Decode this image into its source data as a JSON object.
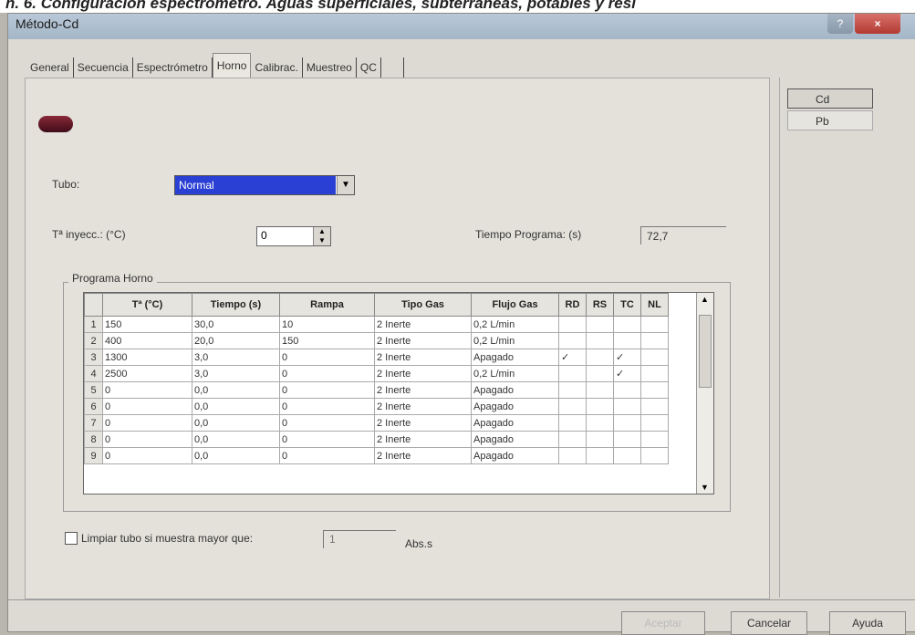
{
  "caption": "n. 6. Configuración espectrómetro. Aguas superficiales, subterráneas, potables y resi",
  "window": {
    "title": "Método-Cd",
    "help_label": "?",
    "close_label": "×"
  },
  "tabs": [
    "General",
    "Secuencia",
    "Espectrómetro",
    "Horno",
    "Calibrac.",
    "Muestreo",
    "QC"
  ],
  "active_tab": "Horno",
  "elements": [
    "Cd",
    "Pb"
  ],
  "form": {
    "tubo_label": "Tubo:",
    "tubo_value": "Normal",
    "tiny_label": "Tª inyecc.: (°C)",
    "tiny_value": "0",
    "tiempo_label": "Tiempo Programa: (s)",
    "tiempo_value": "72,7"
  },
  "program": {
    "group_label": "Programa Horno",
    "headers": [
      "Tª (°C)",
      "Tiempo (s)",
      "Rampa",
      "Tipo Gas",
      "Flujo Gas",
      "RD",
      "RS",
      "TC",
      "NL"
    ],
    "rows": [
      {
        "n": "1",
        "t": "150",
        "time": "30,0",
        "rampa": "10",
        "gas": "2 Inerte",
        "flujo": "0,2 L/min",
        "rd": "",
        "rs": "",
        "tc": "",
        "nl": ""
      },
      {
        "n": "2",
        "t": "400",
        "time": "20,0",
        "rampa": "150",
        "gas": "2 Inerte",
        "flujo": "0,2 L/min",
        "rd": "",
        "rs": "",
        "tc": "",
        "nl": ""
      },
      {
        "n": "3",
        "t": "1300",
        "time": "3,0",
        "rampa": "0",
        "gas": "2 Inerte",
        "flujo": "Apagado",
        "rd": "✓",
        "rs": "",
        "tc": "✓",
        "nl": ""
      },
      {
        "n": "4",
        "t": "2500",
        "time": "3,0",
        "rampa": "0",
        "gas": "2 Inerte",
        "flujo": "0,2 L/min",
        "rd": "",
        "rs": "",
        "tc": "✓",
        "nl": ""
      },
      {
        "n": "5",
        "t": "0",
        "time": "0,0",
        "rampa": "0",
        "gas": "2 Inerte",
        "flujo": "Apagado",
        "rd": "",
        "rs": "",
        "tc": "",
        "nl": ""
      },
      {
        "n": "6",
        "t": "0",
        "time": "0,0",
        "rampa": "0",
        "gas": "2 Inerte",
        "flujo": "Apagado",
        "rd": "",
        "rs": "",
        "tc": "",
        "nl": ""
      },
      {
        "n": "7",
        "t": "0",
        "time": "0,0",
        "rampa": "0",
        "gas": "2 Inerte",
        "flujo": "Apagado",
        "rd": "",
        "rs": "",
        "tc": "",
        "nl": ""
      },
      {
        "n": "8",
        "t": "0",
        "time": "0,0",
        "rampa": "0",
        "gas": "2 Inerte",
        "flujo": "Apagado",
        "rd": "",
        "rs": "",
        "tc": "",
        "nl": ""
      },
      {
        "n": "9",
        "t": "0",
        "time": "0,0",
        "rampa": "0",
        "gas": "2 Inerte",
        "flujo": "Apagado",
        "rd": "",
        "rs": "",
        "tc": "",
        "nl": ""
      }
    ]
  },
  "clean": {
    "label": "Limpiar tubo si muestra mayor que:",
    "value": "1",
    "unit": "Abs.s"
  },
  "buttons": {
    "accept": "Aceptar",
    "cancel": "Cancelar",
    "help": "Ayuda"
  }
}
